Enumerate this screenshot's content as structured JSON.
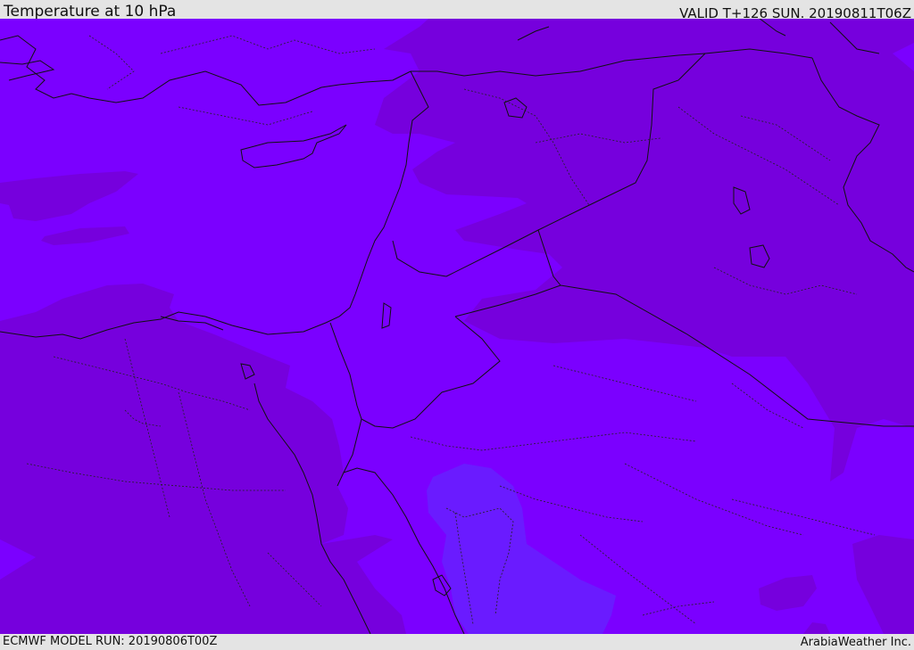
{
  "header": {
    "title": "Temperature at 10 hPa",
    "valid": "VALID T+126 SUN. 20190811T06Z"
  },
  "footer": {
    "model_run": "ECMWF MODEL RUN: 20190806T00Z",
    "credit": "ArabiaWeather Inc."
  },
  "map": {
    "colors": {
      "base_field": "#7b00ff",
      "warmer_field": "#7600dd",
      "cooler_field": "#6a1bff",
      "borders": "#111111"
    }
  }
}
